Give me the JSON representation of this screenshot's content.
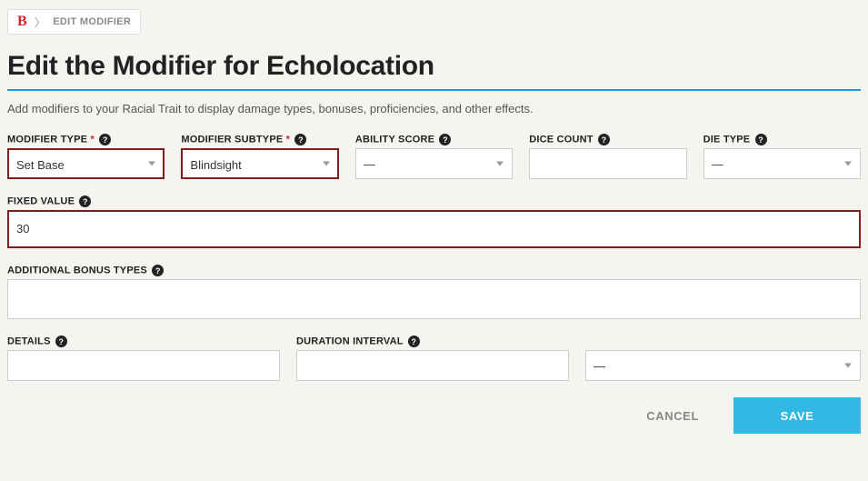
{
  "breadcrumb": {
    "logo": "B",
    "current": "EDIT MODIFIER"
  },
  "header": {
    "title": "Edit the Modifier for Echolocation",
    "description": "Add modifiers to your Racial Trait to display damage types, bonuses, proficiencies, and other effects."
  },
  "fields": {
    "modifier_type": {
      "label": "MODIFIER TYPE",
      "required": true,
      "value": "Set Base"
    },
    "modifier_subtype": {
      "label": "MODIFIER SUBTYPE",
      "required": true,
      "value": "Blindsight"
    },
    "ability_score": {
      "label": "ABILITY SCORE",
      "value": "—"
    },
    "dice_count": {
      "label": "DICE COUNT",
      "value": ""
    },
    "die_type": {
      "label": "DIE TYPE",
      "value": "—"
    },
    "fixed_value": {
      "label": "FIXED VALUE",
      "value": "30"
    },
    "additional_bonus": {
      "label": "ADDITIONAL BONUS TYPES",
      "value": ""
    },
    "details": {
      "label": "DETAILS",
      "value": ""
    },
    "duration_interval": {
      "label": "DURATION INTERVAL",
      "value": ""
    },
    "duration_unit": {
      "label": " ",
      "value": "—"
    }
  },
  "actions": {
    "cancel": "CANCEL",
    "save": "SAVE"
  }
}
